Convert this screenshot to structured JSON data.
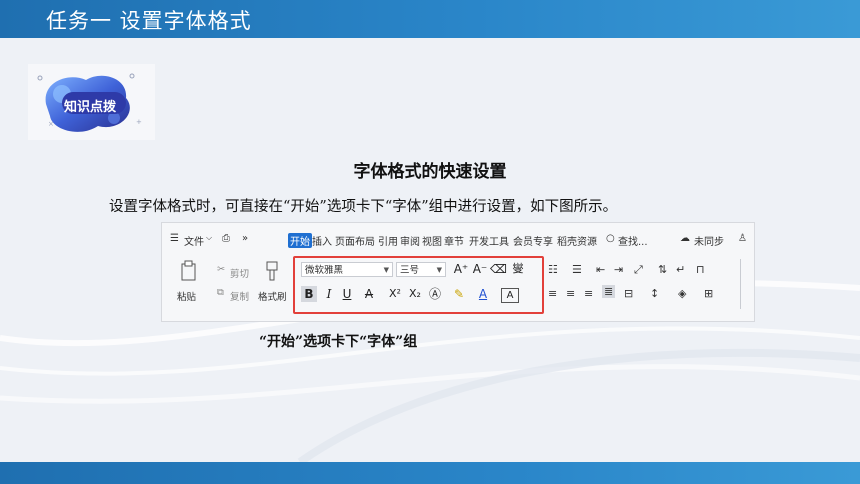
{
  "header": {
    "title": "任务一   设置字体格式"
  },
  "badge": {
    "label": "知识点拨"
  },
  "section": {
    "title": "字体格式的快速设置",
    "body": "设置字体格式时，可直接在“开始”选项卡下“字体”组中进行设置，如下图所示。"
  },
  "ribbon": {
    "tabs": {
      "file": "文件",
      "more": "»",
      "home": "开始",
      "insert": "插入",
      "layout": "页面布局",
      "references": "引用",
      "review": "审阅",
      "view": "视图",
      "chapter": "章节",
      "devtools": "开发工具",
      "member": "会员专享",
      "shell": "稻壳资源",
      "search": "查找...",
      "sync": "未同步"
    },
    "clipboard": {
      "paste": "粘贴",
      "cut": "剪切",
      "copy": "复制",
      "format_painter": "格式刷"
    },
    "font": {
      "name": "微软雅黑",
      "size": "三号",
      "bold": "B",
      "italic": "I",
      "underline": "U",
      "strike": "A",
      "superscript": "X²",
      "subscript": "X₂",
      "grow": "A⁺",
      "shrink": "A⁻",
      "pinyin": "燮"
    }
  },
  "caption": "“开始”选项卡下“字体”组",
  "colors": {
    "accent": "#1f6fb0",
    "highlight_border": "#e2403a",
    "tab_active": "#1f6fd1"
  }
}
